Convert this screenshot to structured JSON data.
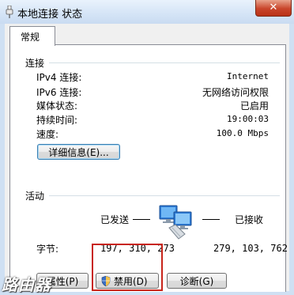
{
  "window": {
    "title": "本地连接 状态",
    "close": "✕"
  },
  "tabs": [
    {
      "label": "常规"
    }
  ],
  "connection": {
    "heading": "连接",
    "rows": [
      {
        "label": "IPv4 连接:",
        "value": "Internet"
      },
      {
        "label": "IPv6 连接:",
        "value": "无网络访问权限"
      },
      {
        "label": "媒体状态:",
        "value": "已启用"
      },
      {
        "label": "持续时间:",
        "value": "19:00:03"
      },
      {
        "label": "速度:",
        "value": "100.0 Mbps"
      }
    ],
    "details_button": "详细信息(E)..."
  },
  "activity": {
    "heading": "活动",
    "sent_label": "已发送",
    "received_label": "已接收",
    "bytes_label": "字节:",
    "bytes_sent": "197, 310, 273",
    "bytes_received": "279, 103, 762"
  },
  "buttons": {
    "properties": "属性(P)",
    "disable": "禁用(D)",
    "diagnose": "诊断(G)"
  },
  "watermark": "路由器"
}
